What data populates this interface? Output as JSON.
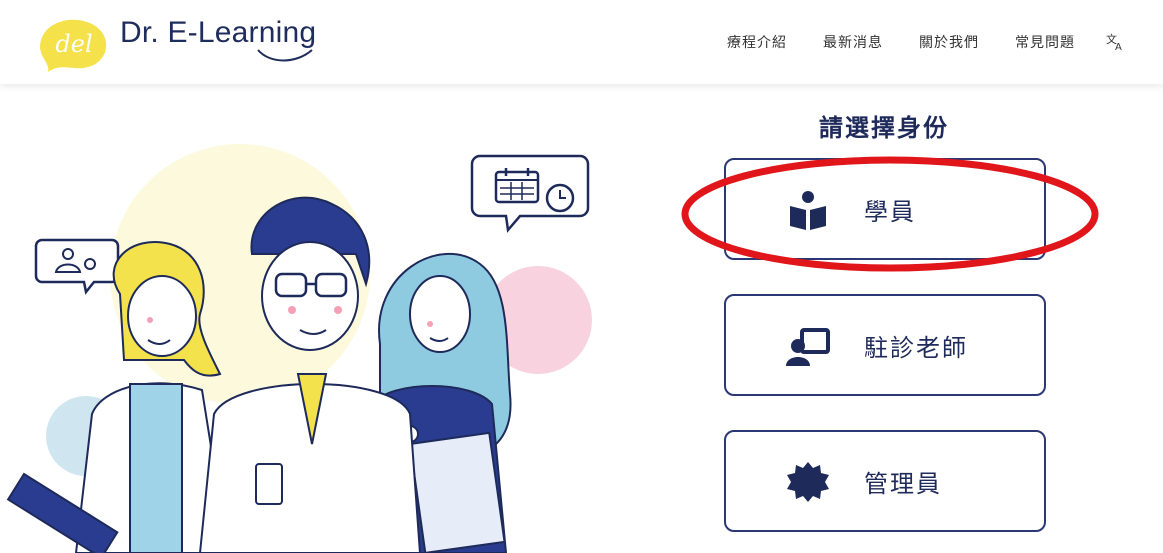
{
  "header": {
    "logo_text": "Dr. E-Learning",
    "logo_mark_text": "del",
    "nav": [
      {
        "label": "療程介紹"
      },
      {
        "label": "最新消息"
      },
      {
        "label": "關於我們"
      },
      {
        "label": "常見問題"
      }
    ],
    "language_icon": "translate-icon"
  },
  "role_select": {
    "title": "請選擇身份",
    "roles": [
      {
        "label": "學員",
        "icon": "student-reading-icon"
      },
      {
        "label": "駐診老師",
        "icon": "teacher-presentation-icon"
      },
      {
        "label": "管理員",
        "icon": "admin-gear-icon"
      }
    ]
  },
  "colors": {
    "navy": "#1e2a5a",
    "logo_yellow": "#f5e14a",
    "annotation_red": "#e0161b"
  }
}
